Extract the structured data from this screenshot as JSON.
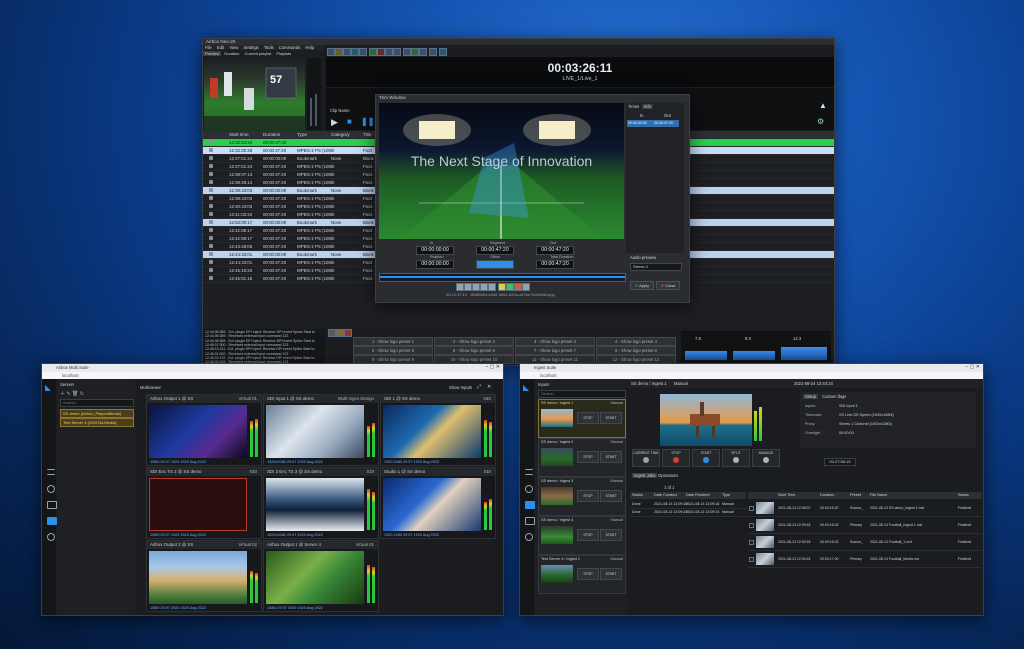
{
  "playout": {
    "title": "Airbox Neo-20",
    "menu": [
      "File",
      "Edit",
      "View",
      "Settings",
      "Tools",
      "Commands",
      "Help"
    ],
    "tabs": [
      "Preview",
      "Duration",
      "Current playlist",
      "Playlists"
    ],
    "clock": "00:03:26:11",
    "live_label": "LIVE_1/Live_1",
    "clip_name_label": "Clip Name",
    "columns": [
      "",
      "Start time",
      "Duration",
      "Type",
      "Category",
      "Title"
    ],
    "rows": [
      {
        "t": "12:32:23:34",
        "d": "00:00:47:20",
        "type": "",
        "cat": "",
        "title": "",
        "hl": "green"
      },
      {
        "t": "12:33:25:28",
        "d": "00:00:47:20",
        "type": "MPEG-2 PS (1080i",
        "cat": "",
        "title": "Foot",
        "hl": "sel"
      },
      {
        "t": "12:37:01:24",
        "d": "00:00:00:00",
        "type": "Bookmark",
        "cat": "None",
        "title": "Block 1",
        "hl": ""
      },
      {
        "t": "12:37:01:24",
        "d": "00:00:47:20",
        "type": "MPEG-2 PS (1080i",
        "cat": "",
        "title": "Foot",
        "hl": ""
      },
      {
        "t": "12:38:07:13",
        "d": "00:00:47:20",
        "type": "MPEG-2 PS (1080i",
        "cat": "",
        "title": "Foot",
        "hl": ""
      },
      {
        "t": "12:39:29:14",
        "d": "00:00:47:20",
        "type": "MPEG-2 PS (1080i",
        "cat": "",
        "title": "Foot",
        "hl": ""
      },
      {
        "t": "12:39:43:03",
        "d": "00:00:00:00",
        "type": "Bookmark",
        "cat": "None",
        "title": "Block 2",
        "hl": "light"
      },
      {
        "t": "12:39:43:03",
        "d": "00:00:47:20",
        "type": "MPEG-2 PS (1080i",
        "cat": "",
        "title": "Foot",
        "hl": ""
      },
      {
        "t": "12:40:43:03",
        "d": "00:00:47:20",
        "type": "MPEG-2 PS (1080i",
        "cat": "",
        "title": "Foot",
        "hl": ""
      },
      {
        "t": "12:41:03:22",
        "d": "00:00:47:20",
        "type": "MPEG-2 PS (1080i",
        "cat": "",
        "title": "Foot",
        "hl": ""
      },
      {
        "t": "12:53:00:17",
        "d": "00:00:00:00",
        "type": "Bookmark",
        "cat": "None",
        "title": "Block 3",
        "hl": "light"
      },
      {
        "t": "12:42:08:17",
        "d": "00:00:47:20",
        "type": "MPEG-2 PS (1080i",
        "cat": "",
        "title": "Foot",
        "hl": ""
      },
      {
        "t": "12:42:58:17",
        "d": "00:00:47:20",
        "type": "MPEG-2 PS (1080i",
        "cat": "",
        "title": "Foot",
        "hl": ""
      },
      {
        "t": "12:43:48:08",
        "d": "00:00:47:20",
        "type": "MPEG-2 PS (1080i",
        "cat": "",
        "title": "Foot",
        "hl": ""
      },
      {
        "t": "12:44:33:01",
        "d": "00:00:00:00",
        "type": "Bookmark",
        "cat": "None",
        "title": "Block 4",
        "hl": "light"
      },
      {
        "t": "12:44:33:01",
        "d": "00:00:47:20",
        "type": "MPEG-2 PS (1080i",
        "cat": "",
        "title": "Foot",
        "hl": ""
      },
      {
        "t": "12:45:19:20",
        "d": "00:00:47:20",
        "type": "MPEG-2 PS (1080i",
        "cat": "",
        "title": "Foot",
        "hl": ""
      },
      {
        "t": "12:46:01:15",
        "d": "00:00:47:20",
        "type": "MPEG-2 PS (1080i",
        "cat": "",
        "title": "Foot",
        "hl": ""
      }
    ],
    "log": [
      "12:44:05:385 - Evt. plugin DPI Inject: Receive DPI event Splice Start to",
      "12:44:05:389 - Received external input command 123",
      "12:44:06:589 - Evt. plugin DPI Inject: Receive DPI event Splice Start to",
      "12:45:07:300 - Received external input command 123",
      "12:45:10:211 - Evt. plugin DPI Inject: Receive DPI event Splice Start to",
      "12:46:01:500 - Received external input command 123",
      "12:46:02:119 - Evt. plugin DPI Inject: Receive DPI event Splice Start to",
      "12:46:03:409 - Received external input command 123"
    ],
    "presets": [
      "1 - Show logo preset 1",
      "2 - Show logo preset 2",
      "3 - Show logo preset 3",
      "4 - Show logo preset 4",
      "5 - Show logo preset 5",
      "6 - Show logo preset 6",
      "7 - Show logo preset 7",
      "8 - Show logo preset 8",
      "9 - Show logo preset 9",
      "10 - Show logo preset 10",
      "11 - Show logo preset 11",
      "12 - Show logo preset 12"
    ],
    "meter_labels": [
      "7.8",
      "8.3",
      "12.3"
    ]
  },
  "trim": {
    "title": "Trim Window",
    "overlay_text": "The Next Stage of Innovation",
    "field_labels": [
      "In",
      "Segment",
      "Out",
      "Position",
      "Offset",
      "Total Duration"
    ],
    "field_values": [
      "00:00:00:00",
      "00:00:47:20",
      "00:00:47:20",
      "00:00:00:00",
      "",
      "00:00:47:20"
    ],
    "filename": "8f185bb4-e4d2-4b51-b22a-a17ee7a49d08.mpg",
    "timecode": "00:12:37:14",
    "tabs": [
      "Times",
      "Info"
    ],
    "times_headers": [
      "In",
      "Out"
    ],
    "times_values": [
      "00:00:00:00",
      "00:00:47:20"
    ],
    "audio_label": "Audio preview",
    "audio_select": "Stereo 1",
    "apply_label": "Apply",
    "close_label": "Close"
  },
  "mv": {
    "app_title": "Airbox Multi Suite",
    "url": "localhost",
    "servers_label": "Servers",
    "search_placeholder": "Search",
    "servers": [
      "SS demo (Airbox_PlayoutMedia)",
      "Test Server 4 (DIGITALMedia)"
    ],
    "panel_title": "Multiviewer",
    "dropdown": "Show Inputs",
    "tiles": [
      {
        "title": "Airbox Output 1 @ SS",
        "tag": "Virtual 01",
        "foot": "1080i 29.97 1920 1920 Aug 2022"
      },
      {
        "title": "SDI Input 1 @ SS demo",
        "tag": "Multi Inges Design",
        "foot": "1920x1080 29.97 1920 Aug 2022"
      },
      {
        "title": "SDI 1 @ SS demo",
        "tag": "NDI",
        "foot": "1920 1080 29.97 1920 Aug 2022"
      },
      {
        "title": "SDI Enc TS 2 @ SS demo",
        "tag": "NDI",
        "foot": "1080i 29.97 1920 1920 Aug 2022"
      },
      {
        "title": "SDI 3 Enc TS 3 @ SS demo",
        "tag": "SDI",
        "foot": "1920x1080 29.97 1920 Aug 2022"
      },
      {
        "title": "Studio 1 @ SS demo",
        "tag": "SDI",
        "foot": "1920 1080 29.97 1920 Aug 2022"
      },
      {
        "title": "Airbox Output 2 @ SS",
        "tag": "Virtual 02",
        "foot": "1080i 29.97 1920 1920 Aug 2022"
      },
      {
        "title": "Airbox Output 1 @ Server 4",
        "tag": "Virtual 01",
        "foot": "1080i 29.97 1920 1920 Aug 2022"
      }
    ]
  },
  "ingest": {
    "app_title": "Ingest Suite",
    "url": "localhost",
    "inputs_label": "Inputs",
    "search_placeholder": "Search",
    "inputs": [
      {
        "name": "SS demo / Ingest 1",
        "tag": "Manual"
      },
      {
        "name": "SS demo / Ingest 2",
        "tag": "Manual"
      },
      {
        "name": "SS demo / Ingest 3",
        "tag": "Manual"
      },
      {
        "name": "SS demo / Ingest 4",
        "tag": "Manual"
      },
      {
        "name": "Test Server 4 / Ingest 1",
        "tag": "Manual"
      }
    ],
    "stop_label": "STOP",
    "start_label": "START",
    "header_input": "SS demo / Ingest 1",
    "header_mode": "Manual",
    "header_time": "2021-08-24 13:44:24",
    "tabs": [
      "Setup",
      "Custom flags"
    ],
    "setup_labels": [
      "Inputs",
      "Timecode",
      "Proxy",
      "Overlight"
    ],
    "setup_values": [
      "SDI input 1",
      "SS Live-SS Speed (1920x1080i)",
      "Stereo 1 Channel (1920x1080i)",
      "00:00:00"
    ],
    "buttons": [
      "CURRENT TIME",
      "STOP",
      "START",
      "SPLIT",
      "MANAGE"
    ],
    "duration": "00:27:56:15",
    "jobs_tabs": [
      "Ingest Jobs",
      "Operations"
    ],
    "jobs_columns": [
      "Status",
      "Date Created",
      "Date Finished",
      "Type"
    ],
    "jobs_rows": [
      [
        "Done",
        "2021-08-13 13:09:18",
        "2021-08-13 13:09:18",
        "Manual"
      ],
      [
        "Done",
        "2021-08-13 13:09:24",
        "2021-08-13 13:09:24",
        "Manual"
      ]
    ],
    "files_columns": [
      "Start Time",
      "Duration",
      "Preset",
      "File Name",
      "Status"
    ],
    "files_rows": [
      [
        "2021-08-13 12:08:07",
        "00:00:15:20",
        "Source_",
        "2021-08-13 SS demo_Ingest 1.mxf",
        "Finished"
      ],
      [
        "2021-08-13 12:09:18",
        "00:00:16:02",
        "Primary",
        "2021-08-13 Football_Ingest 1.mxf",
        "Finished"
      ],
      [
        "2021-08-13 12:09:18",
        "00:00:16:02",
        "Source_",
        "2021-08-13 Football_1.mxf",
        "Finished"
      ],
      [
        "2021-08-13 12:09:24",
        "00:00:17:00",
        "Primary",
        "2021-08-13 Football_Media.mxf",
        "Finished"
      ]
    ],
    "page_info": "1 of 1"
  },
  "colors": {
    "accent_green": "#2ad04a",
    "accent_blue": "#2f8fe8",
    "select": "#c9dcf5"
  }
}
